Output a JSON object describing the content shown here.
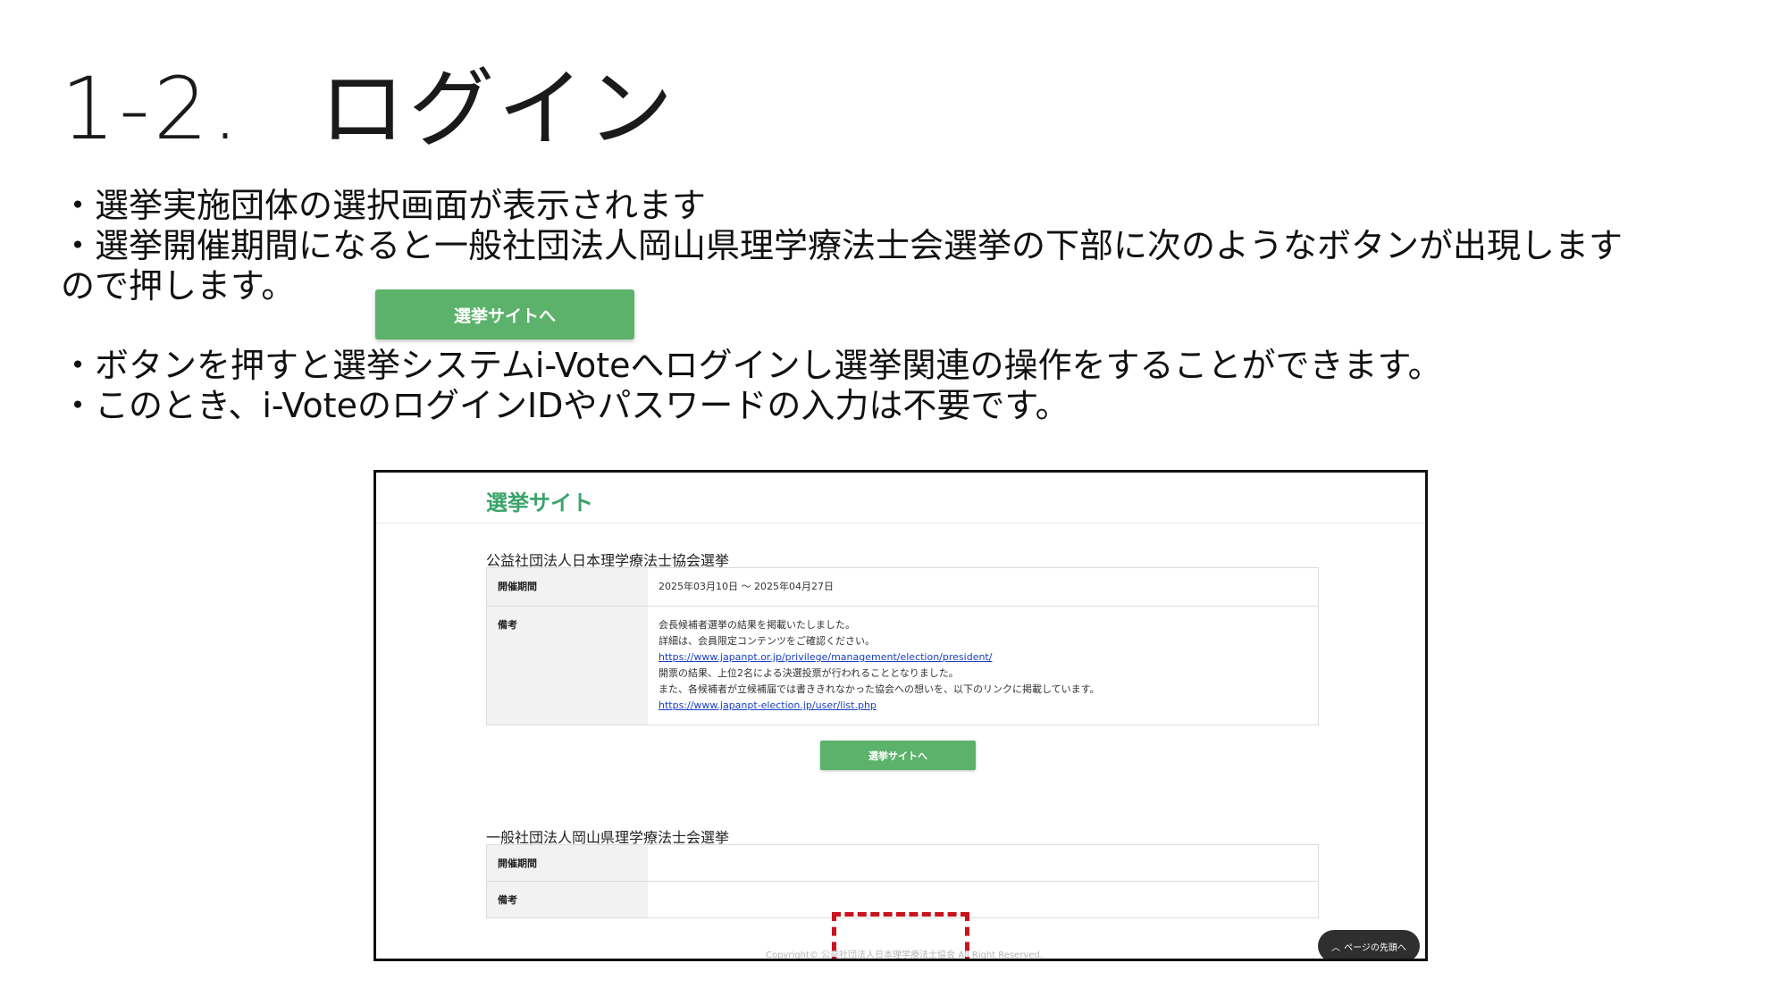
{
  "slide": {
    "title_number": "1-2.",
    "title_text": "ログイン",
    "bullets": [
      "・選挙実施団体の選択画面が表示されます",
      "・選挙開催期間になると一般社団法人岡山県理学療法士会選挙の下部に次のようなボタンが出現します",
      "ので押します。",
      "・ボタンを押すと選挙システムi-Voteへログインし選挙関連の操作をすることができます。",
      "・このとき、i-VoteのログインIDやパスワードの入力は不要です。"
    ],
    "sample_button_label": "選挙サイトへ"
  },
  "screenshot": {
    "site_title": "選挙サイト",
    "sections": [
      {
        "title": "公益社団法人日本理学療法士協会選挙",
        "period_label": "開催期間",
        "period_value": "2025年03月10日 ～ 2025年04月27日",
        "notes_label": "備考",
        "notes": [
          "会長候補者選挙の結果を掲載いたしました。",
          "詳細は、会員限定コンテンツをご確認ください。",
          "https://www.japanpt.or.jp/privilege/management/election/president/",
          "開票の結果、上位2名による決選投票が行われることとなりました。",
          "また、各候補者が立候補届では書ききれなかった協会への想いを、以下のリンクに掲載しています。",
          "https://www.japanpt-election.jp/user/list.php"
        ],
        "button_label": "選挙サイトへ"
      },
      {
        "title": "一般社団法人岡山県理学療法士会選挙",
        "period_label": "開催期間",
        "period_value": "",
        "notes_label": "備考",
        "notes_value": ""
      }
    ],
    "copyright": "Copyright© 公益社団法人日本理学療法士協会 All Right Reserved.",
    "page_top_label": "ページの先頭へ"
  },
  "colors": {
    "button_green": "#5cb26b",
    "site_title_green": "#3aa36b",
    "highlight_red": "#c8141e",
    "link_blue": "#1a3fbf"
  }
}
